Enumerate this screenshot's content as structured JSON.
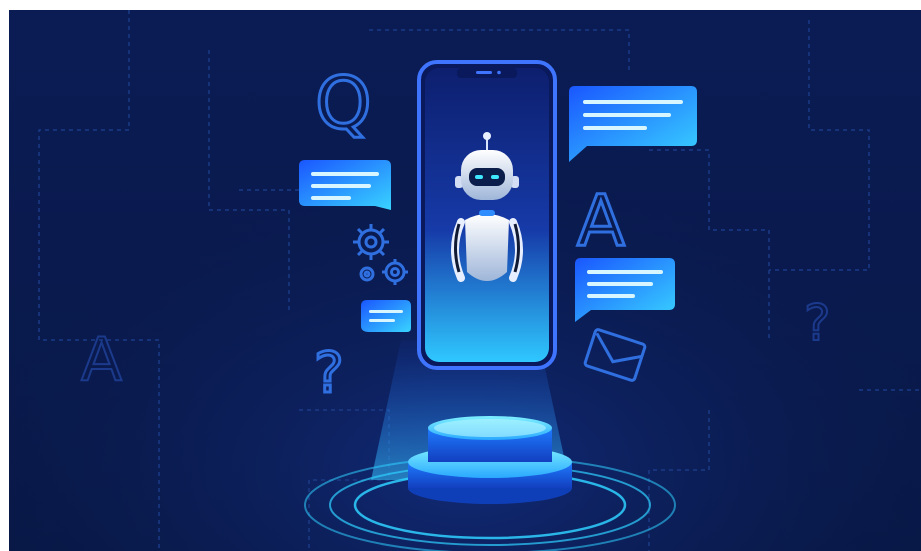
{
  "scene": {
    "glyphs": {
      "q": "Q",
      "a": "A",
      "a_faint": "A",
      "question_left": "?",
      "question_right": "?"
    },
    "colors": {
      "background_top": "#0a1a4f",
      "background_bottom": "#08194a",
      "phone_border": "#3b6cf0",
      "accent_cyan": "#33d6ff",
      "bubble_blue": "#1e8bff",
      "icon_stroke": "#2f6fe0",
      "circuit_lines": "#1b3a86"
    },
    "icons": [
      "robot-icon",
      "gear-icon",
      "envelope-icon",
      "chat-bubble-icon",
      "question-mark-icon"
    ]
  }
}
